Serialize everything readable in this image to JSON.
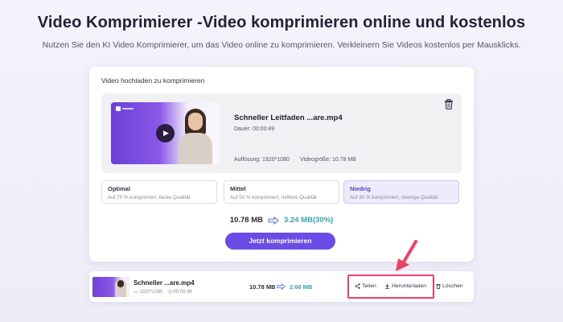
{
  "page": {
    "title": "Video Komprimierer -Video komprimieren online und kostenlos",
    "subtitle": "Nutzen Sie den KI Video Komprimierer, um das Video online zu komprimieren. Verkleinern Sie Videos kostenlos per Mausklicks."
  },
  "upload": {
    "label": "Video hochladen zu komprimieren",
    "file_name": "Schneller Leitfaden ...are.mp4",
    "duration": "Dauer: 00:00:49",
    "resolution": "Auflösung: 1920*1080",
    "filesize": "Videogröße: 10.78 MB"
  },
  "options": [
    {
      "title": "Optimal",
      "desc": "Auf 70 % komprimiert, beste Qualität",
      "selected": false
    },
    {
      "title": "Mittel",
      "desc": "Auf 50 % komprimiert, mittlere Qualität",
      "selected": false
    },
    {
      "title": "Niedrig",
      "desc": "Auf 30 % komprimiert, niedrige Qualität",
      "selected": true
    }
  ],
  "result": {
    "original_size": "10.78 MB",
    "compressed_size": "3.24 MB(30%)"
  },
  "compress_button": "Jetzt komprimieren",
  "output": {
    "file_name": "Schneller ...are.mp4",
    "resolution": "1920*1080",
    "duration": "00:00:49",
    "original_size": "10.78 MB",
    "compressed_size": "2.68 MB",
    "share_label": "Teilen",
    "download_label": "Herunterladen",
    "delete_label": "Löschen"
  },
  "colors": {
    "accent": "#6b4ce6",
    "result_teal": "#2fa9b0",
    "highlight": "#ee3f66"
  },
  "icons": {
    "play": "play-icon",
    "trash": "trash-icon",
    "arrow": "right-arrow-icon",
    "share": "share-icon",
    "download": "download-icon",
    "delete": "trash-icon"
  }
}
